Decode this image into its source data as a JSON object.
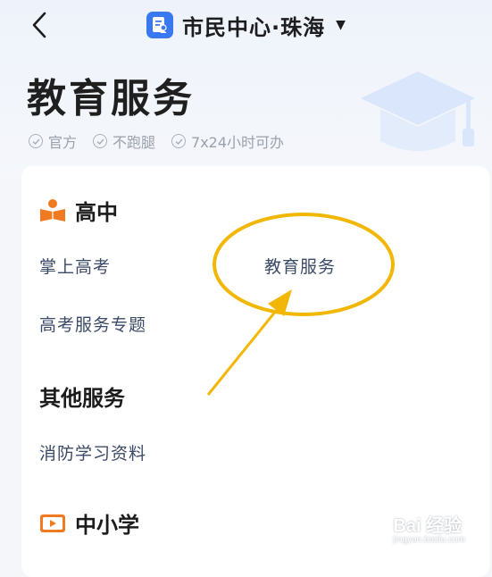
{
  "header": {
    "title": "市民中心·珠海",
    "caret": "▼",
    "back_icon": "chevron-left-icon",
    "app_icon": "document-person-icon",
    "brand_color": "#3a78f2"
  },
  "page": {
    "title": "教育服务",
    "tags": [
      "官方",
      "不跑腿",
      "7x24小时可办"
    ]
  },
  "sections": {
    "high_school": {
      "title": "高中",
      "icon": "book-reader-icon",
      "icon_color": "#f07a22"
    },
    "other": {
      "title": "其他服务"
    },
    "k12": {
      "title": "中小学",
      "icon": "video-play-icon",
      "icon_color": "#f07a22"
    }
  },
  "links": {
    "gaokao": "掌上高考",
    "education_service": "教育服务",
    "gaokao_topic": "高考服务专题",
    "fire_safety": "消防学习资料"
  },
  "annotation": {
    "color": "#f2b705"
  },
  "watermark": {
    "main": "Bai 经验",
    "sub": "jingyan.baidu.com"
  }
}
